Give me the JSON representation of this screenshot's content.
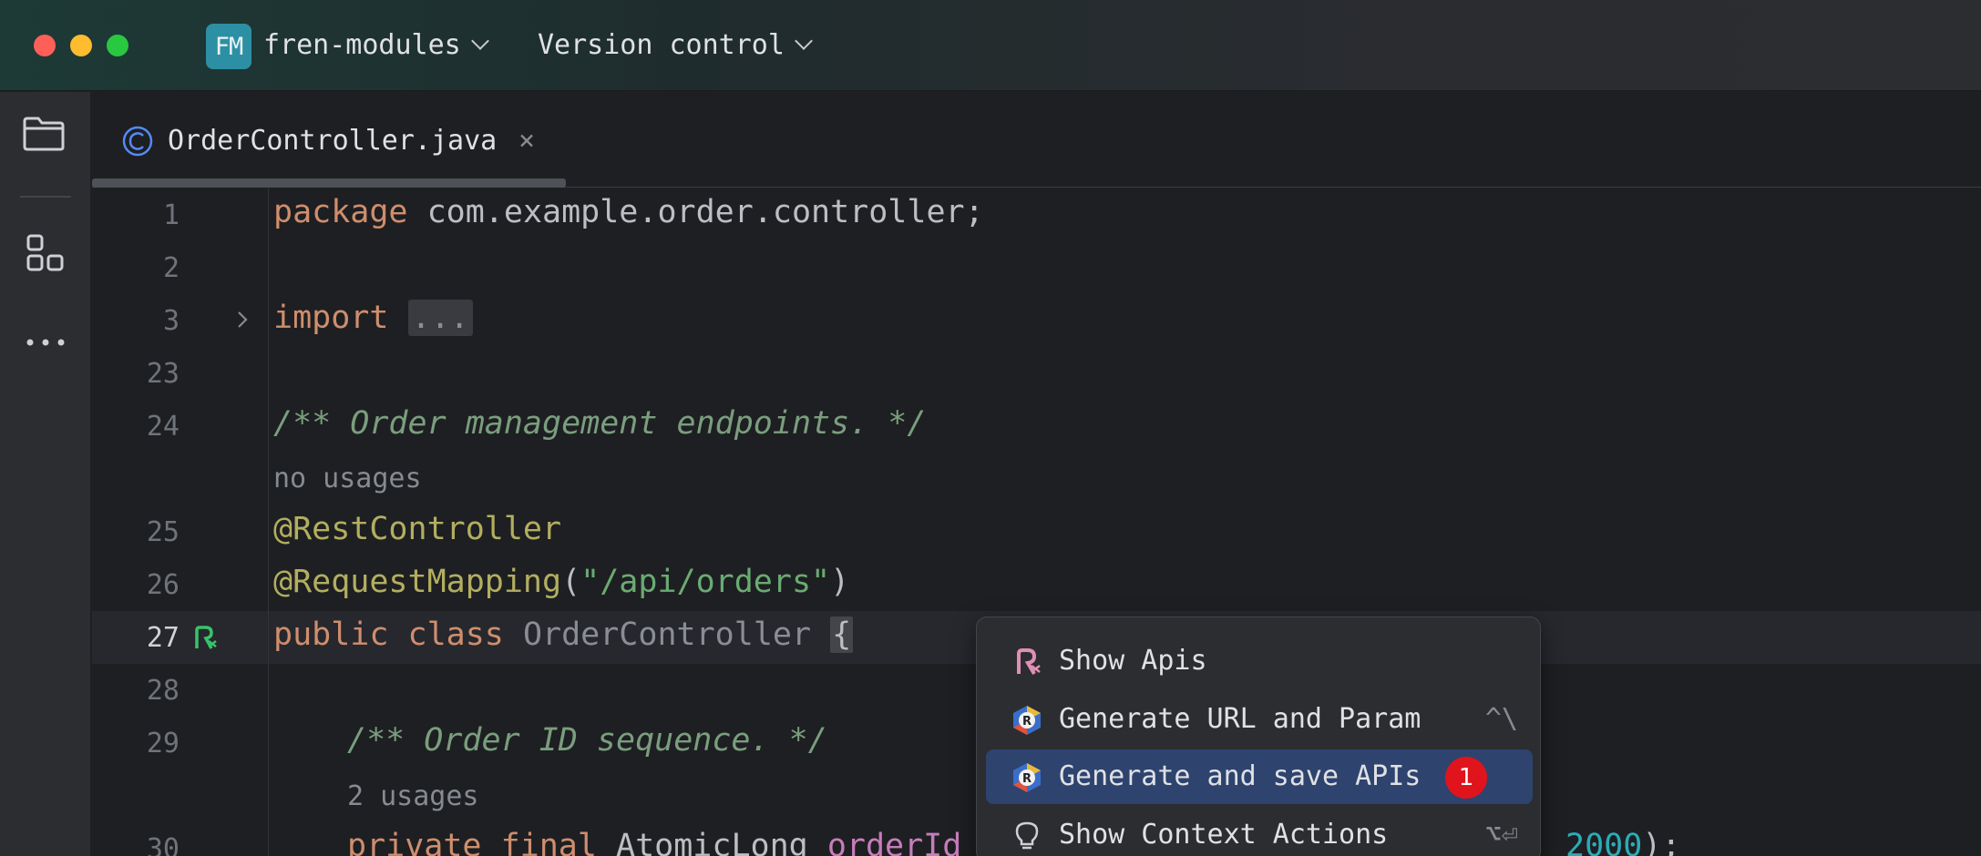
{
  "titlebar": {
    "project_badge": "FM",
    "project_name": "fren-modules",
    "version_control": "Version control"
  },
  "tab": {
    "filename": "OrderController.java",
    "close": "×"
  },
  "editor": {
    "lines": [
      {
        "num": "1"
      },
      {
        "num": "2"
      },
      {
        "num": "3"
      },
      {
        "num": "23"
      },
      {
        "num": "24"
      },
      {
        "num": "25"
      },
      {
        "num": "26"
      },
      {
        "num": "27"
      },
      {
        "num": "28"
      },
      {
        "num": "29"
      },
      {
        "num": "30"
      }
    ],
    "code": {
      "l1_kw": "package",
      "l1_rest": " com.example.order.controller;",
      "l3_kw": "import",
      "l3_fold": "...",
      "l24_comment": "/** Order management endpoints. */",
      "hint_no_usages": "no usages",
      "l25_ann": "@RestController",
      "l26_ann": "@RequestMapping",
      "l26_open": "(",
      "l26_str": "\"/api/orders\"",
      "l26_close": ")",
      "l27_kw": "public class",
      "l27_cls": "OrderController",
      "l27_brace": "{",
      "l29_comment": "/** Order ID sequence. */",
      "hint_2_usages": "2 usages",
      "l30_kw": "private final",
      "l30_type": "AtomicLong",
      "l30_field": "orderId",
      "l30_eq": " =",
      "l30_num": "2000",
      "l30_end": ");"
    }
  },
  "popup": {
    "items": [
      {
        "label": "Show Apis",
        "shortcut": "",
        "icon": "show-apis-icon"
      },
      {
        "label": "Generate URL and Param",
        "shortcut": "^\\",
        "icon": "restful-plugin-icon"
      },
      {
        "label": "Generate and save APIs",
        "shortcut": "",
        "icon": "restful-plugin-icon",
        "badge": "1",
        "selected": true
      },
      {
        "label": "Show Context Actions",
        "shortcut": "⌥⏎",
        "icon": "lightbulb-icon"
      }
    ]
  },
  "colors": {
    "keyword": "#cf8e6d",
    "annotation": "#b3ae60",
    "string": "#6aab73",
    "comment": "#7a9e7e",
    "selection": "#2e436e",
    "badge": "#e0141c"
  }
}
